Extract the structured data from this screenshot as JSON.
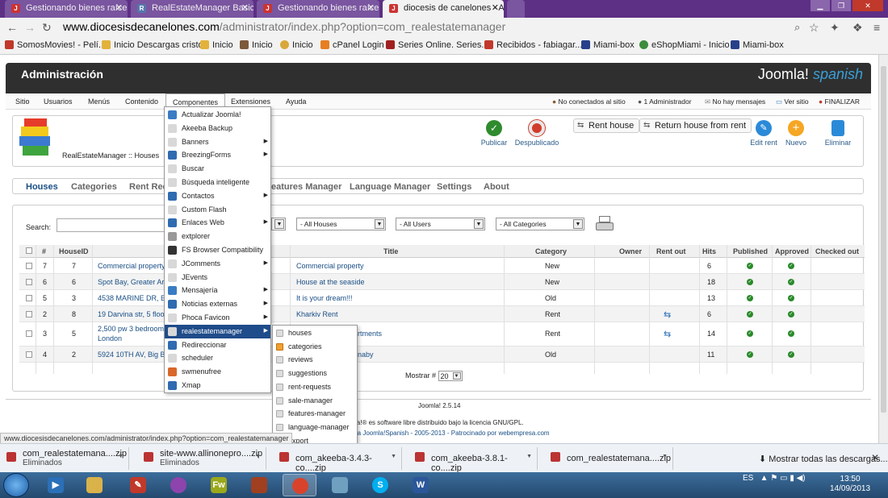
{
  "browser": {
    "tabs": [
      {
        "label": "Gestionando bienes raíces",
        "icon": "joomla-icon"
      },
      {
        "label": "RealEstateManager Basic -",
        "icon": "realestate-icon"
      },
      {
        "label": "Gestionando bienes raíces",
        "icon": "joomla-icon"
      },
      {
        "label": "diocesis de canelones - Ad",
        "icon": "joomla-icon"
      }
    ],
    "url_host": "www.diocesisdecanelones.com",
    "url_path": "/administrator/index.php?option=com_realestatemanager",
    "bookmarks": [
      "SomosMovies! - Pelí...",
      "Inicio Descargas cristo",
      "Inicio",
      "Inicio",
      "Inicio",
      "cPanel Login",
      "Series Online. Series...",
      "Recibidos - fabiagar...",
      "Miami-box",
      "eShopMiami - Inicio",
      "Miami-box"
    ]
  },
  "admin": {
    "title": "Administración",
    "logo_text": "Joomla!",
    "logo_sub": "spanish",
    "menu": [
      "Sitio",
      "Usuarios",
      "Menús",
      "Contenido",
      "Componentes",
      "Extensiones",
      "Ayuda"
    ],
    "status": {
      "visitors": "No conectados al sitio",
      "admins": "1 Administrador",
      "messages": "No hay mensajes",
      "view_site": "Ver sitio",
      "logout": "FINALIZAR"
    }
  },
  "toolbar": {
    "component_title": "RealEstateManager :: Houses",
    "publish": "Publicar",
    "unpublish": "Despublicado",
    "rent_house": "Rent house",
    "return_house": "Return house from rent",
    "edit_rent": "Edit rent",
    "new": "Nuevo",
    "delete": "Eliminar"
  },
  "subtabs": [
    "Houses",
    "Categories",
    "Rent Requ",
    "eatures Manager",
    "Language Manager",
    "Settings",
    "About"
  ],
  "filters": {
    "search_label": "Search:",
    "houses": "- All Houses",
    "users": "- All Users",
    "categories": "- All Categories"
  },
  "table": {
    "headers": {
      "hash": "#",
      "houseid": "HouseID",
      "title": "Title",
      "category": "Category",
      "owner": "Owner",
      "rentout": "Rent out",
      "hits": "Hits",
      "published": "Published",
      "approved": "Approved",
      "checkedout": "Checked out"
    },
    "rows": [
      {
        "num": "7",
        "houseid": "7",
        "address": "Commercial property",
        "title": "Commercial property",
        "category": "New",
        "hits": "6",
        "rent": false
      },
      {
        "num": "6",
        "houseid": "6",
        "address": "Spot Bay, Greater Ar",
        "title": "House at the seaside",
        "category": "New",
        "hits": "18",
        "rent": false
      },
      {
        "num": "5",
        "houseid": "3",
        "address": "4538 MARINE DR, Big",
        "title": "It is your dream!!!",
        "category": "Old",
        "hits": "13",
        "rent": false
      },
      {
        "num": "2",
        "houseid": "8",
        "address": "19 Darvina str, 5 floo",
        "title": "Kharkiv Rent",
        "category": "Rent",
        "hits": "6",
        "rent": true
      },
      {
        "num": "3",
        "houseid": "5",
        "address": "2,500 pw 3 bedroom",
        "address2": "London",
        "title": "rtments",
        "category": "Rent",
        "hits": "14",
        "rent": true
      },
      {
        "num": "4",
        "houseid": "2",
        "address": "5924 10TH AV, Big B",
        "title": "naby",
        "category": "Old",
        "hits": "11",
        "rent": false
      }
    ],
    "mostrar_label": "Mostrar #",
    "mostrar_value": "20"
  },
  "footer": {
    "version": "Joomla! 2.5.14",
    "license": "la!® es software libre distribuido bajo la licencia GNU/GPL.",
    "credits": "ra Joomla!Spanish - 2005-2013 - Patrocinado por webempresa.com"
  },
  "components_menu": [
    {
      "label": "Actualizar Joomla!",
      "color": "#3a7cc4",
      "sub": false
    },
    {
      "label": "Akeeba Backup",
      "color": "#d8d8d8",
      "sub": false
    },
    {
      "label": "Banners",
      "color": "#d8d8d8",
      "sub": true
    },
    {
      "label": "BreezingForms",
      "color": "#2f6bb0",
      "sub": true
    },
    {
      "label": "Buscar",
      "color": "#d8d8d8",
      "sub": false
    },
    {
      "label": "Búsqueda inteligente",
      "color": "#d8d8d8",
      "sub": false
    },
    {
      "label": "Contactos",
      "color": "#2f6bb0",
      "sub": true
    },
    {
      "label": "Custom Flash",
      "color": "#d8d8d8",
      "sub": false
    },
    {
      "label": "Enlaces Web",
      "color": "#2f6bb0",
      "sub": true
    },
    {
      "label": "extplorer",
      "color": "#999999",
      "sub": false
    },
    {
      "label": "FS Browser Compatibility",
      "color": "#333333",
      "sub": false
    },
    {
      "label": "JComments",
      "color": "#d8d8d8",
      "sub": true
    },
    {
      "label": "JEvents",
      "color": "#d8d8d8",
      "sub": false
    },
    {
      "label": "Mensajería",
      "color": "#3a7cc4",
      "sub": true
    },
    {
      "label": "Noticias externas",
      "color": "#2f6bb0",
      "sub": true
    },
    {
      "label": "Phoca Favicon",
      "color": "#d8d8d8",
      "sub": true
    },
    {
      "label": "realestatemanager",
      "color": "#d8d8d8",
      "sub": true
    },
    {
      "label": "Redireccionar",
      "color": "#2f6bb0",
      "sub": false
    },
    {
      "label": "scheduler",
      "color": "#d8d8d8",
      "sub": false
    },
    {
      "label": "swmenufree",
      "color": "#d9672a",
      "sub": false
    },
    {
      "label": "Xmap",
      "color": "#2f6bb0",
      "sub": false
    }
  ],
  "realestate_submenu": [
    "houses",
    "categories",
    "reviews",
    "suggestions",
    "rent-requests",
    "sale-manager",
    "features-manager",
    "language-manager",
    "export"
  ],
  "status_url": "www.diocesisdecanelones.com/administrator/index.php?option=com_realestatemanager",
  "downloads": [
    {
      "name": "com_realestatemana....zip",
      "sub": "Eliminados"
    },
    {
      "name": "site-www.allinonepro....zip",
      "sub": "Eliminados"
    },
    {
      "name": "com_akeeba-3.4.3-co....zip",
      "sub": ""
    },
    {
      "name": "com_akeeba-3.8.1-co....zip",
      "sub": ""
    },
    {
      "name": "com_realestatemana....zip",
      "sub": ""
    }
  ],
  "downloads_show_all": "Mostrar todas las descargas...",
  "taskbar": {
    "lang": "ES",
    "time": "13:50",
    "date": "14/09/2013"
  }
}
